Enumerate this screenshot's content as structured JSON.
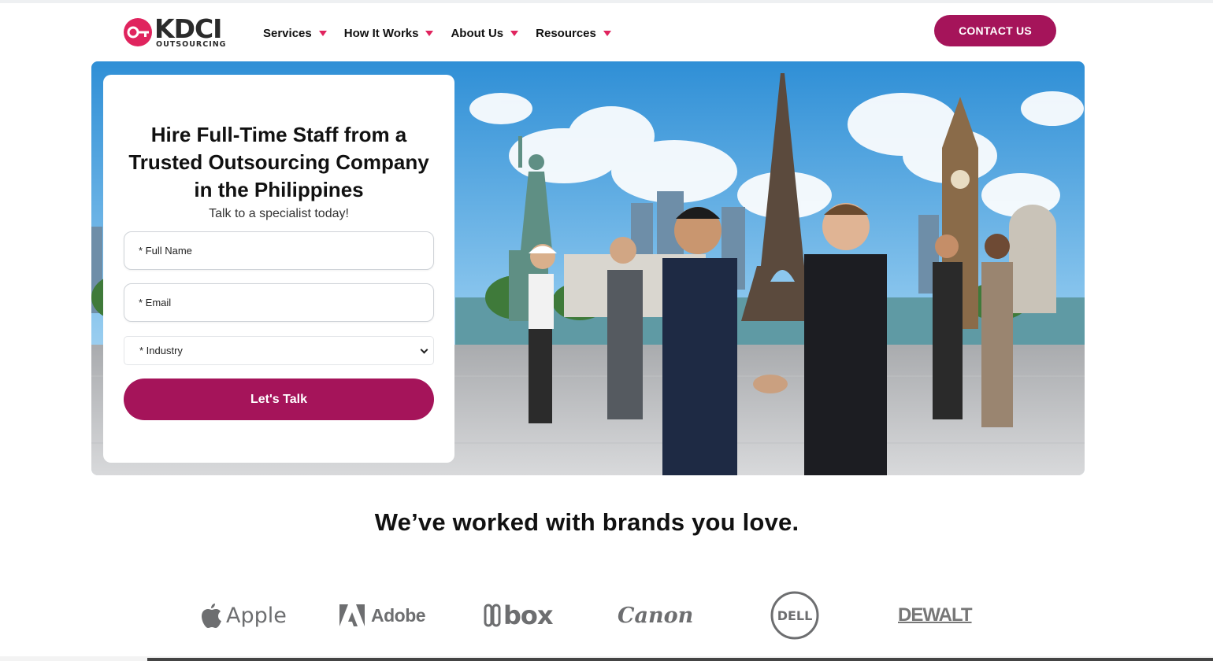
{
  "header": {
    "logo_word": "KDCI",
    "logo_sub": "OUTSOURCING",
    "nav": [
      {
        "label": "Services"
      },
      {
        "label": "How It Works"
      },
      {
        "label": "About Us"
      },
      {
        "label": "Resources"
      }
    ],
    "contact_label": "CONTACT US"
  },
  "colors": {
    "brand": "#a5145a",
    "accent": "#e0245e",
    "text": "#111111"
  },
  "hero": {
    "image_subject": "business-handshake-landmarks-illustration",
    "form": {
      "title": "Hire Full-Time Staff from a Trusted Outsourcing Company in the Philippines",
      "subtitle": "Talk to a specialist today!",
      "full_name_placeholder": "* Full Name",
      "email_placeholder": "* Email",
      "industry_selected": "* Industry",
      "submit_label": "Let's Talk"
    }
  },
  "brands": {
    "title": "We’ve worked with brands you love.",
    "logos": [
      {
        "name": "Apple",
        "icon": "apple-icon"
      },
      {
        "name": "Adobe",
        "icon": "adobe-icon"
      },
      {
        "name": "box",
        "icon": "box-icon"
      },
      {
        "name": "Canon",
        "icon": ""
      },
      {
        "name": "DELL",
        "icon": "dell-icon"
      },
      {
        "name": "DEWALT",
        "icon": ""
      }
    ]
  }
}
